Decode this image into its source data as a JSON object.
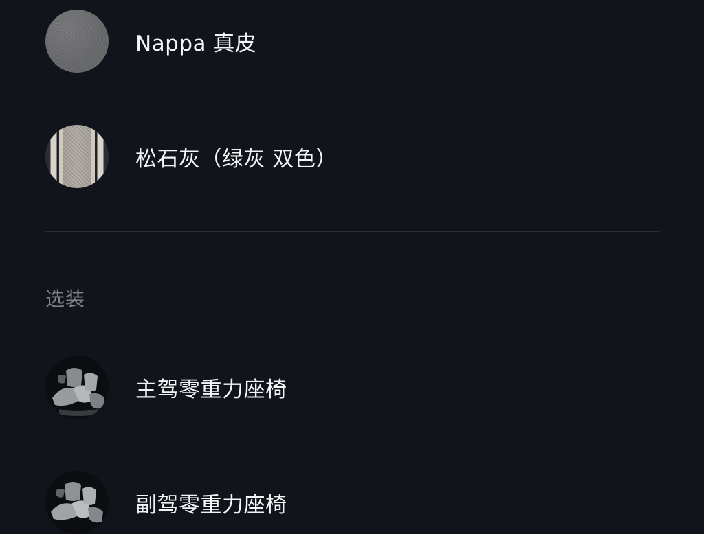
{
  "options": [
    {
      "label": "Nappa 真皮",
      "icon": "nappa-leather-swatch-icon"
    },
    {
      "label": "松石灰（绿灰 双色）",
      "icon": "turquoise-gray-stripe-swatch-icon"
    }
  ],
  "section": {
    "title": "选装",
    "items": [
      {
        "label": "主驾零重力座椅",
        "icon": "driver-seat-icon"
      },
      {
        "label": "副驾零重力座椅",
        "icon": "passenger-seat-icon"
      }
    ]
  },
  "colors": {
    "background": "#11141b",
    "text": "#f4f5f7",
    "muted": "#7f838b",
    "divider": "#2a2e36"
  }
}
